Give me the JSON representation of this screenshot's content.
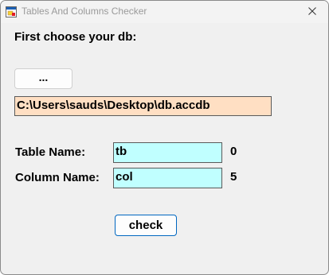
{
  "window": {
    "title": "Tables And Columns Checker",
    "icon": "app-form-icon",
    "close_icon": "close-icon"
  },
  "form": {
    "heading": "First choose your db:",
    "browse_button_label": "...",
    "db_path_value": "C:\\Users\\sauds\\Desktop\\db.accdb",
    "table_name_label": "Table Name:",
    "table_name_value": "tb",
    "table_count": "0",
    "column_name_label": "Column Name:",
    "column_name_value": "col",
    "column_count": "5",
    "check_button_label": "check"
  },
  "colors": {
    "path_field_bg": "#ffdfc3",
    "name_field_bg": "#c0ffff",
    "check_button_border": "#0067c0",
    "window_bg": "#f0f0f0"
  }
}
